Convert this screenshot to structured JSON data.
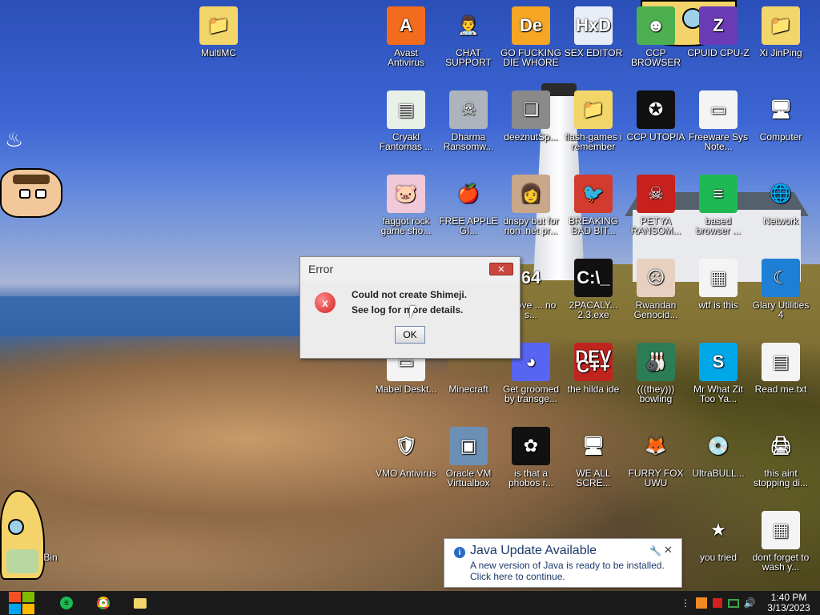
{
  "desktop": {
    "icons": [
      {
        "label": "MultiMC",
        "glyph": "📁",
        "bg": "#f2d66a"
      },
      {
        "label": "Avast Antivirus",
        "glyph": "A",
        "bg": "#f36b1c"
      },
      {
        "label": "CHAT SUPPORT",
        "glyph": "👨‍⚕",
        "bg": "transparent"
      },
      {
        "label": "GO FUCKING DIE WHORE",
        "glyph": "De",
        "bg": "#f5a623"
      },
      {
        "label": "SEX EDITOR",
        "glyph": "HxD",
        "bg": "#e8eef8"
      },
      {
        "label": "CCP BROWSER",
        "glyph": "☻",
        "bg": "#4caf50"
      },
      {
        "label": "CPUID CPU-Z",
        "glyph": "Z",
        "bg": "#6a3bb5"
      },
      {
        "label": "Xi JinPing",
        "glyph": "📁",
        "bg": "#f2d66a"
      },
      {
        "label": "Cryakl Fantomas ...",
        "glyph": "▤",
        "bg": "#e8f0e8"
      },
      {
        "label": "Dharma Ransomw...",
        "glyph": "☠",
        "bg": "#aeb4bb"
      },
      {
        "label": "deeznutSp...",
        "glyph": "❏",
        "bg": "#8a8a8a"
      },
      {
        "label": "flash-games i remember",
        "glyph": "📁",
        "bg": "#f2d66a"
      },
      {
        "label": "CCP UTOPIA",
        "glyph": "✪",
        "bg": "#111111"
      },
      {
        "label": "Freeware Sys Note...",
        "glyph": "▭",
        "bg": "#f4f4f4"
      },
      {
        "label": "Computer",
        "glyph": "🖥",
        "bg": "transparent"
      },
      {
        "label": "faggot rock game sho...",
        "glyph": "🐷",
        "bg": "#f0c8d8"
      },
      {
        "label": "FREE APPLE GI...",
        "glyph": "🍎",
        "bg": "transparent"
      },
      {
        "label": "dnspy but for non .net pr...",
        "glyph": "👩",
        "bg": "#c8a888"
      },
      {
        "label": "BREAKING BAD BIT...",
        "glyph": "🐦",
        "bg": "#d33b2f"
      },
      {
        "label": "PETYA RANSOM...",
        "glyph": "☠",
        "bg": "#c8201c"
      },
      {
        "label": "based browser ...",
        "glyph": "≡",
        "bg": "#1fb954"
      },
      {
        "label": "Network",
        "glyph": "🌐",
        "bg": "transparent"
      },
      {
        "label": "above ... no s...",
        "glyph": "64",
        "bg": "transparent"
      },
      {
        "label": "2PACALY... 2.3.exe",
        "glyph": "C:\\_",
        "bg": "#111111"
      },
      {
        "label": "Rwandan Genocid...",
        "glyph": "☹",
        "bg": "#e8d0c0"
      },
      {
        "label": "wtf is this",
        "glyph": "▦",
        "bg": "#f4f4f4"
      },
      {
        "label": "Glary Utilities 4",
        "glyph": "☾",
        "bg": "#1e7fd6"
      },
      {
        "label": "Mabel Deskt...",
        "glyph": "▭",
        "bg": "#f4f4f4"
      },
      {
        "label": "Minecraft",
        "glyph": "",
        "bg": "transparent"
      },
      {
        "label": "Get groomed by transge...",
        "glyph": "◕",
        "bg": "#5865f2"
      },
      {
        "label": "the hilda ide",
        "glyph": "DEV C++",
        "bg": "#c0241e"
      },
      {
        "label": "(((they))) bowling",
        "glyph": "🎳",
        "bg": "#2c7d55"
      },
      {
        "label": "Mr What Zit Too Ya...",
        "glyph": "S",
        "bg": "#00a8e8"
      },
      {
        "label": "Read me.txt",
        "glyph": "▤",
        "bg": "#f4f4f4"
      },
      {
        "label": "VMO Antivirus",
        "glyph": "🛡",
        "bg": "transparent"
      },
      {
        "label": "Oracle VM Virtualbox",
        "glyph": "▣",
        "bg": "#6c8fb5"
      },
      {
        "label": "is that a phobos r...",
        "glyph": "✿",
        "bg": "#111111"
      },
      {
        "label": "WE ALL SCRE...",
        "glyph": "🖥",
        "bg": "transparent"
      },
      {
        "label": "FURRY FOX UWU",
        "glyph": "🦊",
        "bg": "transparent"
      },
      {
        "label": "UltraBULL...",
        "glyph": "💿",
        "bg": "transparent"
      },
      {
        "label": "this aint stopping di...",
        "glyph": "🖨",
        "bg": "transparent"
      },
      {
        "label": "Bin",
        "glyph": "",
        "bg": "transparent"
      },
      {
        "label": "you tried",
        "glyph": "★",
        "bg": "transparent"
      },
      {
        "label": "dont forget to wash y...",
        "glyph": "▦",
        "bg": "#f4f4f4"
      }
    ]
  },
  "error_dialog": {
    "title": "Error",
    "close_glyph": "✕",
    "icon_glyph": "x",
    "line1": "Could not create Shimeji.",
    "line2": "See log for more details.",
    "ok_label": "OK"
  },
  "java_toast": {
    "info_glyph": "i",
    "title": "Java Update Available",
    "line1": "A new version of Java is ready to be installed.",
    "line2": "Click here to continue.",
    "close_glyph": "✕",
    "settings_glyph": "🔧"
  },
  "taskbar": {
    "pinned": [
      {
        "name": "spotify",
        "glyph": "≡",
        "color": "#1db954"
      },
      {
        "name": "chrome",
        "glyph": "◉",
        "color": "#e94235"
      },
      {
        "name": "explorer",
        "glyph": "▬",
        "color": "#f2d66a"
      }
    ],
    "tray_overflow_glyph": "⋮",
    "time": "1:40 PM",
    "date": "3/13/2023"
  },
  "colors": {
    "start_logo": [
      "#f25022",
      "#7fba00",
      "#00a4ef",
      "#ffb900"
    ]
  }
}
